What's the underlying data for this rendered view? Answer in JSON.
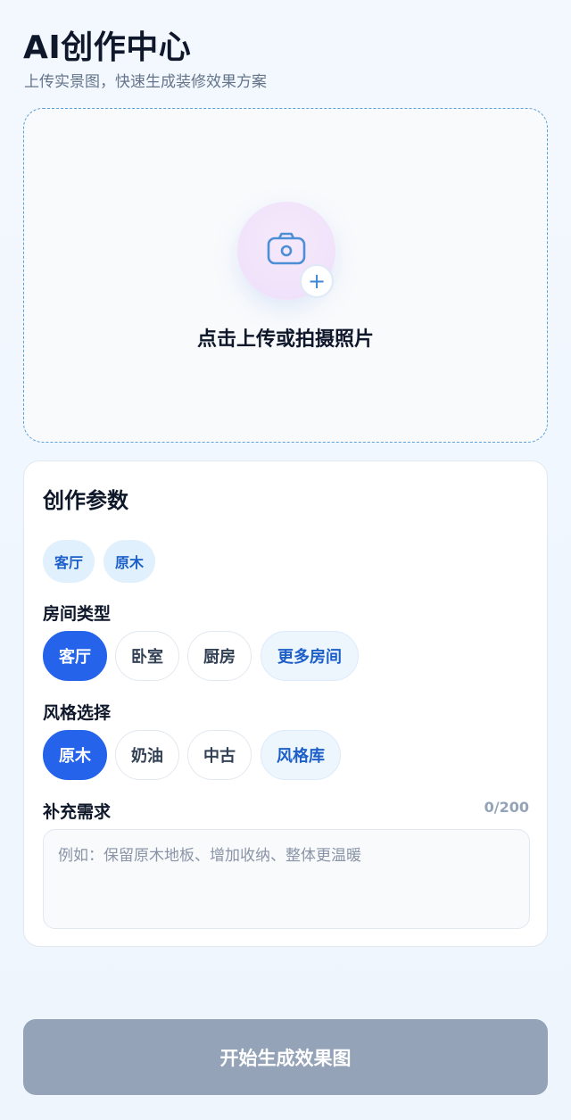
{
  "header": {
    "title": "AI创作中心",
    "subtitle": "上传实景图，快速生成装修效果方案"
  },
  "upload": {
    "label": "点击上传或拍摄照片",
    "plus_symbol": "+",
    "icon": "camera-icon",
    "accent_color": "#5ba0d8"
  },
  "params": {
    "title": "创作参数",
    "selected_tags": [
      "客厅",
      "原木"
    ],
    "room": {
      "label": "房间类型",
      "options": [
        "客厅",
        "卧室",
        "厨房"
      ],
      "selected": "客厅",
      "more_label": "更多房间"
    },
    "style": {
      "label": "风格选择",
      "options": [
        "原木",
        "奶油",
        "中古"
      ],
      "selected": "原木",
      "more_label": "风格库"
    },
    "notes": {
      "label": "补充需求",
      "counter": "0/200",
      "value": "",
      "placeholder": "例如：保留原木地板、增加收纳、整体更温暖"
    }
  },
  "action": {
    "generate_label": "开始生成效果图",
    "disabled_color": "#94a3b8"
  },
  "colors": {
    "primary": "#2563eb",
    "tag_bg": "#e0f0fd",
    "tag_text": "#1d5fc8"
  }
}
